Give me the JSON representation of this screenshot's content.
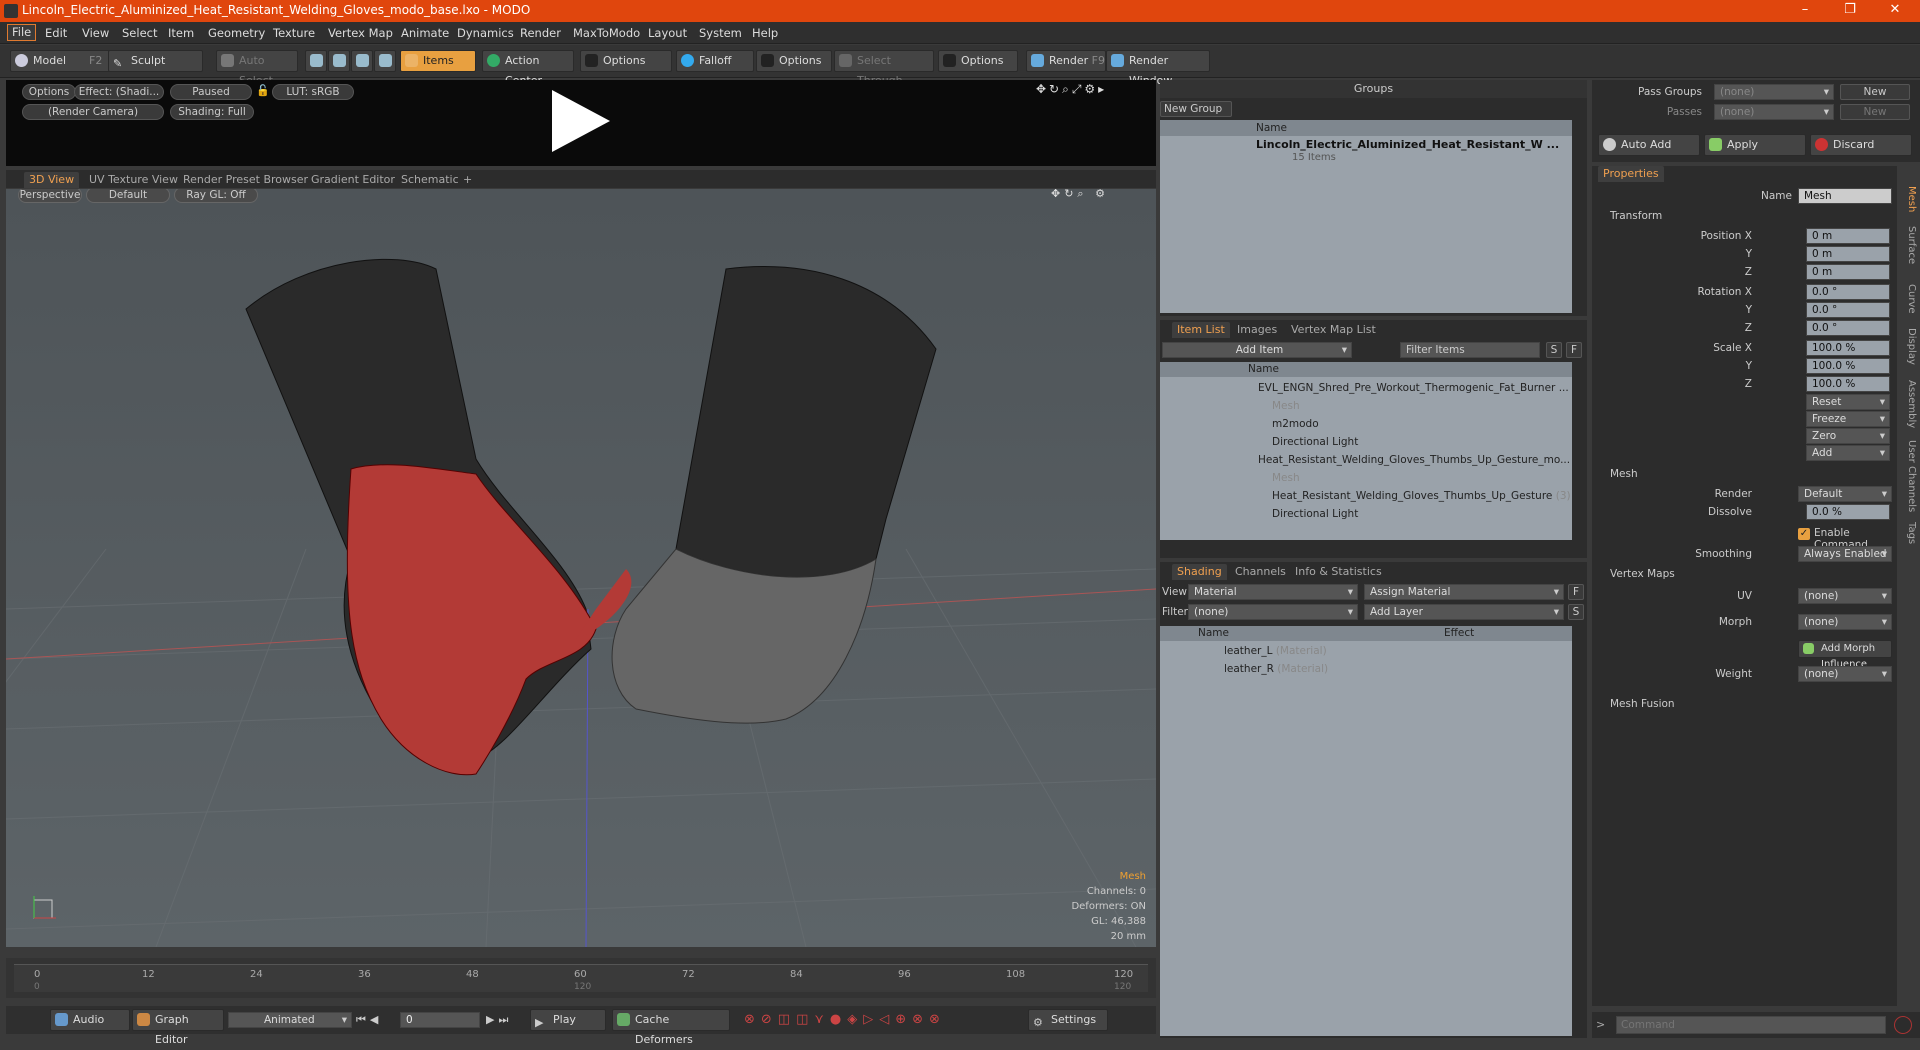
{
  "window": {
    "title": "Lincoln_Electric_Aluminized_Heat_Resistant_Welding_Gloves_modo_base.lxo - MODO",
    "min": "–",
    "max": "❐",
    "close": "✕"
  },
  "menu": [
    "File",
    "Edit",
    "View",
    "Select",
    "Item",
    "Geometry",
    "Texture",
    "Vertex Map",
    "Animate",
    "Dynamics",
    "Render",
    "MaxToModo",
    "Layout",
    "System",
    "Help"
  ],
  "toolbar": {
    "model": "Model",
    "model_key": "F2",
    "sculpt": "Sculpt",
    "auto_select": "Auto Select",
    "items": "Items",
    "action_center": "Action Center",
    "options1": "Options",
    "falloff": "Falloff",
    "options2": "Options",
    "select_through": "Select Through",
    "options3": "Options",
    "render": "Render",
    "render_key": "F9",
    "render_window": "Render Window"
  },
  "preview": {
    "options": "Options",
    "effect": "Effect: (Shadi...",
    "paused": "Paused",
    "lut": "LUT: sRGB",
    "camera": "(Render Camera)",
    "shading": "Shading: Full"
  },
  "viewtabs": {
    "tabs": [
      "3D View",
      "UV Texture View",
      "Render Preset Browser",
      "Gradient Editor",
      "Schematic"
    ],
    "add": "+"
  },
  "viewport": {
    "perspective": "Perspective",
    "default": "Default",
    "raygl": "Ray GL: Off",
    "info_mesh": "Mesh",
    "channels": "Channels: 0",
    "deformers": "Deformers: ON",
    "gl": "GL: 46,388",
    "scale": "20 mm"
  },
  "timeline": {
    "ticks": [
      "0",
      "12",
      "24",
      "36",
      "48",
      "60",
      "72",
      "84",
      "96",
      "108",
      "120"
    ],
    "start": "0",
    "mid": "120",
    "end": "120"
  },
  "transport": {
    "audio": "Audio",
    "graph_editor": "Graph Editor",
    "animated": "Animated",
    "frame": "0",
    "play": "Play",
    "cache": "Cache Deformers",
    "settings": "Settings"
  },
  "groups": {
    "title": "Groups",
    "new_group": "New Group",
    "col_name": "Name",
    "item_name": "Lincoln_Electric_Aluminized_Heat_Resistant_W ...",
    "item_count": "15 Items"
  },
  "itemlist": {
    "tabs": [
      "Item List",
      "Images",
      "Vertex Map List"
    ],
    "add_item": "Add Item",
    "filter": "Filter Items",
    "s": "S",
    "f": "F",
    "col_name": "Name",
    "rows": [
      {
        "name": "EVL_ENGN_Shred_Pre_Workout_Thermogenic_Fat_Burner ...",
        "sub": ""
      },
      {
        "name": "Mesh",
        "sub": ""
      },
      {
        "name": "m2modo",
        "sub": ""
      },
      {
        "name": "Directional Light",
        "sub": ""
      },
      {
        "name": "Heat_Resistant_Welding_Gloves_Thumbs_Up_Gesture_mo...",
        "sub": ""
      },
      {
        "name": "Mesh",
        "sub": ""
      },
      {
        "name": "Heat_Resistant_Welding_Gloves_Thumbs_Up_Gesture",
        "sub": "(3)"
      },
      {
        "name": "Directional Light",
        "sub": ""
      }
    ]
  },
  "shading": {
    "tabs": [
      "Shading",
      "Channels",
      "Info & Statistics"
    ],
    "view_label": "View",
    "view_value": "Material",
    "assign": "Assign Material",
    "filter_label": "Filter",
    "filter_value": "(none)",
    "add_layer": "Add Layer",
    "f": "F",
    "s": "S",
    "col_name": "Name",
    "col_effect": "Effect",
    "rows": [
      {
        "name": "leather_L",
        "type": "(Material)"
      },
      {
        "name": "leather_R",
        "type": "(Material)"
      }
    ]
  },
  "right": {
    "pass_groups": "Pass Groups",
    "passes": "Passes",
    "none1": "(none)",
    "none2": "(none)",
    "new1": "New",
    "new2": "New",
    "auto_add": "Auto Add",
    "apply": "Apply",
    "discard": "Discard"
  },
  "properties": {
    "tab": "Properties",
    "name_label": "Name",
    "name_value": "Mesh",
    "transform": "Transform",
    "pos_label": "Position X",
    "y": "Y",
    "z": "Z",
    "pos": [
      "0 m",
      "0 m",
      "0 m"
    ],
    "rot_label": "Rotation X",
    "rot": [
      "0.0 °",
      "0.0 °",
      "0.0 °"
    ],
    "scale_label": "Scale X",
    "scale": [
      "100.0 %",
      "100.0 %",
      "100.0 %"
    ],
    "reset": "Reset",
    "freeze": "Freeze",
    "zero": "Zero",
    "add": "Add",
    "mesh": "Mesh",
    "render_label": "Render",
    "render_value": "Default",
    "dissolve_label": "Dissolve",
    "dissolve_value": "0.0 %",
    "enable_cmd": "Enable Command Regions",
    "smoothing_label": "Smoothing",
    "smoothing_value": "Always Enabled",
    "vertex_maps": "Vertex Maps",
    "uv_label": "UV",
    "uv_value": "(none)",
    "morph_label": "Morph",
    "morph_value": "(none)",
    "add_morph": "Add Morph Influence",
    "weight_label": "Weight",
    "weight_value": "(none)",
    "mesh_fusion": "Mesh Fusion",
    "vtabs": [
      "Mesh",
      "Surface",
      "Curve",
      "Display",
      "Assembly",
      "User Channels",
      "Tags"
    ]
  },
  "command": {
    "placeholder": "Command"
  }
}
